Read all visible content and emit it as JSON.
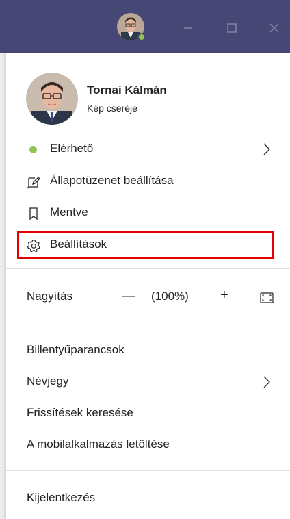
{
  "window": {
    "minimize_icon": "minimize-icon",
    "maximize_icon": "maximize-icon",
    "close_icon": "close-icon",
    "accent": "#464775"
  },
  "profile": {
    "name": "Tornai Kálmán",
    "change_picture": "Kép cseréje",
    "presence_color": "#92c353"
  },
  "menu": {
    "status": "Elérhető",
    "status_message": "Állapotüzenet beállítása",
    "saved": "Mentve",
    "settings": "Beállítások",
    "zoom_label": "Nagyítás",
    "zoom_minus": "—",
    "zoom_value": "(100%)",
    "zoom_plus": "+",
    "shortcuts": "Billentyűparancsok",
    "about": "Névjegy",
    "check_updates": "Frissítések keresése",
    "download_mobile": "A mobilalkalmazás letöltése",
    "sign_out": "Kijelentkezés"
  },
  "highlight_color": "#e60000"
}
